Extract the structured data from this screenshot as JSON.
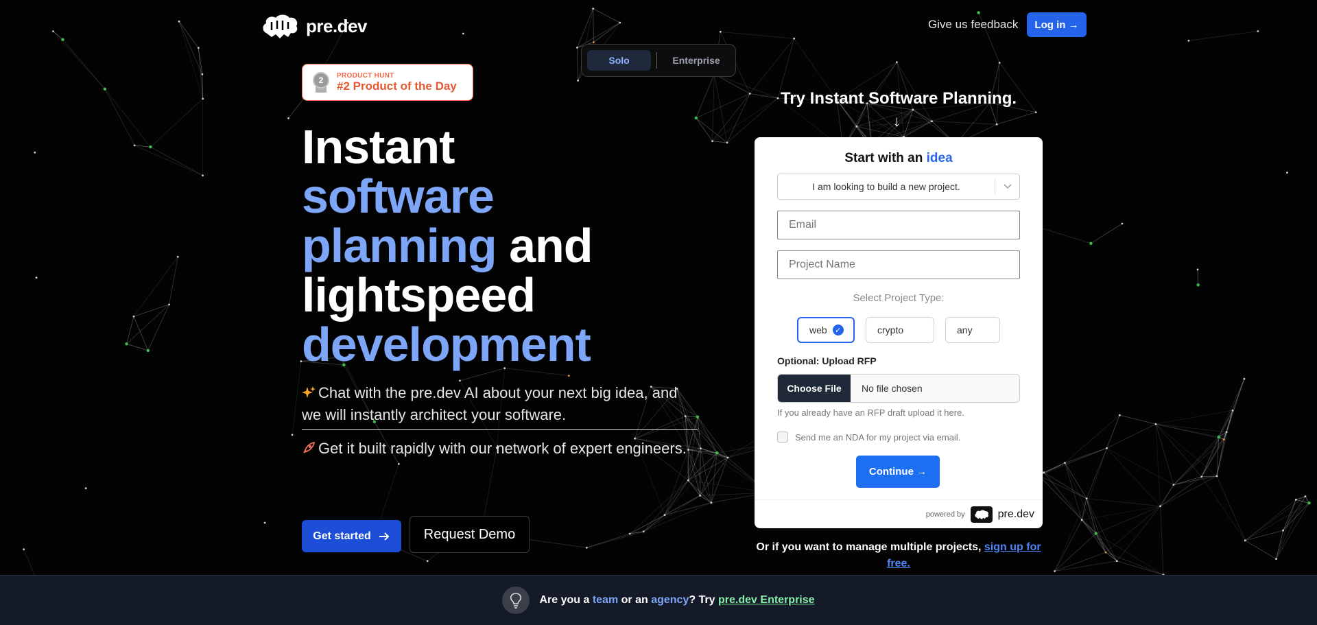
{
  "header": {
    "logo_text": "pre.dev",
    "feedback_label": "Give us feedback",
    "login_label": "Log in →"
  },
  "plan_toggle": {
    "solo_label": "Solo",
    "enterprise_label": "Enterprise"
  },
  "product_hunt": {
    "small_label": "PRODUCT HUNT",
    "main_label": "#2 Product of the Day",
    "medal_number": "2"
  },
  "hero": {
    "line1": "Instant",
    "line2": "software",
    "line3a": "planning",
    "line3b": " and",
    "line4": "lightspeed",
    "line5": "development"
  },
  "bullets": [
    {
      "icon": "sparkles-icon",
      "text": "Chat with the pre.dev AI about your next big idea, and we will instantly architect your software."
    },
    {
      "icon": "rocket-icon",
      "text": "Get it built rapidly with our network of expert engineers."
    }
  ],
  "cta": {
    "get_started_label": "Get started",
    "demo_label": "Request Demo"
  },
  "form": {
    "heading": "Try Instant Software Planning.",
    "title_prefix": "Start with an ",
    "title_highlight": "idea",
    "select_value": "I am looking to build a new project.",
    "email_placeholder": "Email",
    "project_placeholder": "Project Name",
    "type_label": "Select Project Type:",
    "types": [
      "web",
      "crypto",
      "any"
    ],
    "selected_type": "web",
    "rfp_label": "Optional: Upload RFP",
    "file_button": "Choose File",
    "file_status": "No file chosen",
    "rfp_hint": "If you already have an RFP draft upload it here.",
    "nda_label": "Send me an NDA for my project via email.",
    "continue_label": "Continue →",
    "powered_by": "powered by",
    "powered_name": "pre.dev"
  },
  "multi": {
    "text": "Or if you want to manage multiple projects, ",
    "link": "sign up for free."
  },
  "bottom_bar": {
    "a": "Are you a ",
    "team": "team",
    "b": " or an ",
    "agency": "agency",
    "c": "? Try ",
    "link": "pre.dev Enterprise"
  },
  "colors": {
    "accent_blue": "#2563eb",
    "hero_blue": "#7ea6f8",
    "link_green": "#86efac",
    "badge_orange": "#e5572f"
  }
}
